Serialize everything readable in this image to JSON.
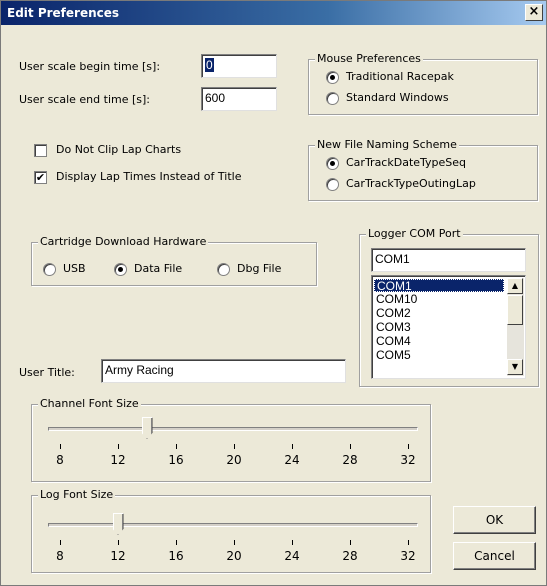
{
  "window": {
    "title": "Edit Preferences",
    "close_glyph": "×"
  },
  "scale": {
    "begin_label": "User scale begin time [s]:",
    "begin_value": "0",
    "end_label": "User scale end time [s]:",
    "end_value": "600"
  },
  "mouse": {
    "group_label": "Mouse Preferences",
    "options": [
      "Traditional Racepak",
      "Standard Windows"
    ],
    "selected": "Traditional Racepak"
  },
  "file_naming": {
    "group_label": "New File Naming Scheme",
    "options": [
      "CarTrackDateTypeSeq",
      "CarTrackTypeOutingLap"
    ],
    "selected": "CarTrackDateTypeSeq"
  },
  "checkboxes": {
    "no_clip_label": "Do Not Clip Lap Charts",
    "no_clip_checked": false,
    "lap_times_label": "Display Lap Times Instead of Title",
    "lap_times_checked": true,
    "check_glyph": "✔"
  },
  "cartridge": {
    "group_label": "Cartridge Download Hardware",
    "options": [
      "USB",
      "Data File",
      "Dbg File"
    ],
    "selected": "Data File"
  },
  "logger": {
    "group_label": "Logger COM Port",
    "value": "COM1",
    "ports": [
      "COM1",
      "COM10",
      "COM2",
      "COM3",
      "COM4",
      "COM5"
    ],
    "selected": "COM1",
    "scroll_up_glyph": "▲",
    "scroll_down_glyph": "▼"
  },
  "user_title": {
    "label": "User Title:",
    "value": "Army Racing"
  },
  "channel_font": {
    "group_label": "Channel Font Size",
    "ticks": [
      "8",
      "12",
      "16",
      "20",
      "24",
      "28",
      "32"
    ],
    "value": 14
  },
  "log_font": {
    "group_label": "Log Font Size",
    "ticks": [
      "8",
      "12",
      "16",
      "20",
      "24",
      "28",
      "32"
    ],
    "value": 12
  },
  "buttons": {
    "ok": "OK",
    "cancel": "Cancel"
  }
}
